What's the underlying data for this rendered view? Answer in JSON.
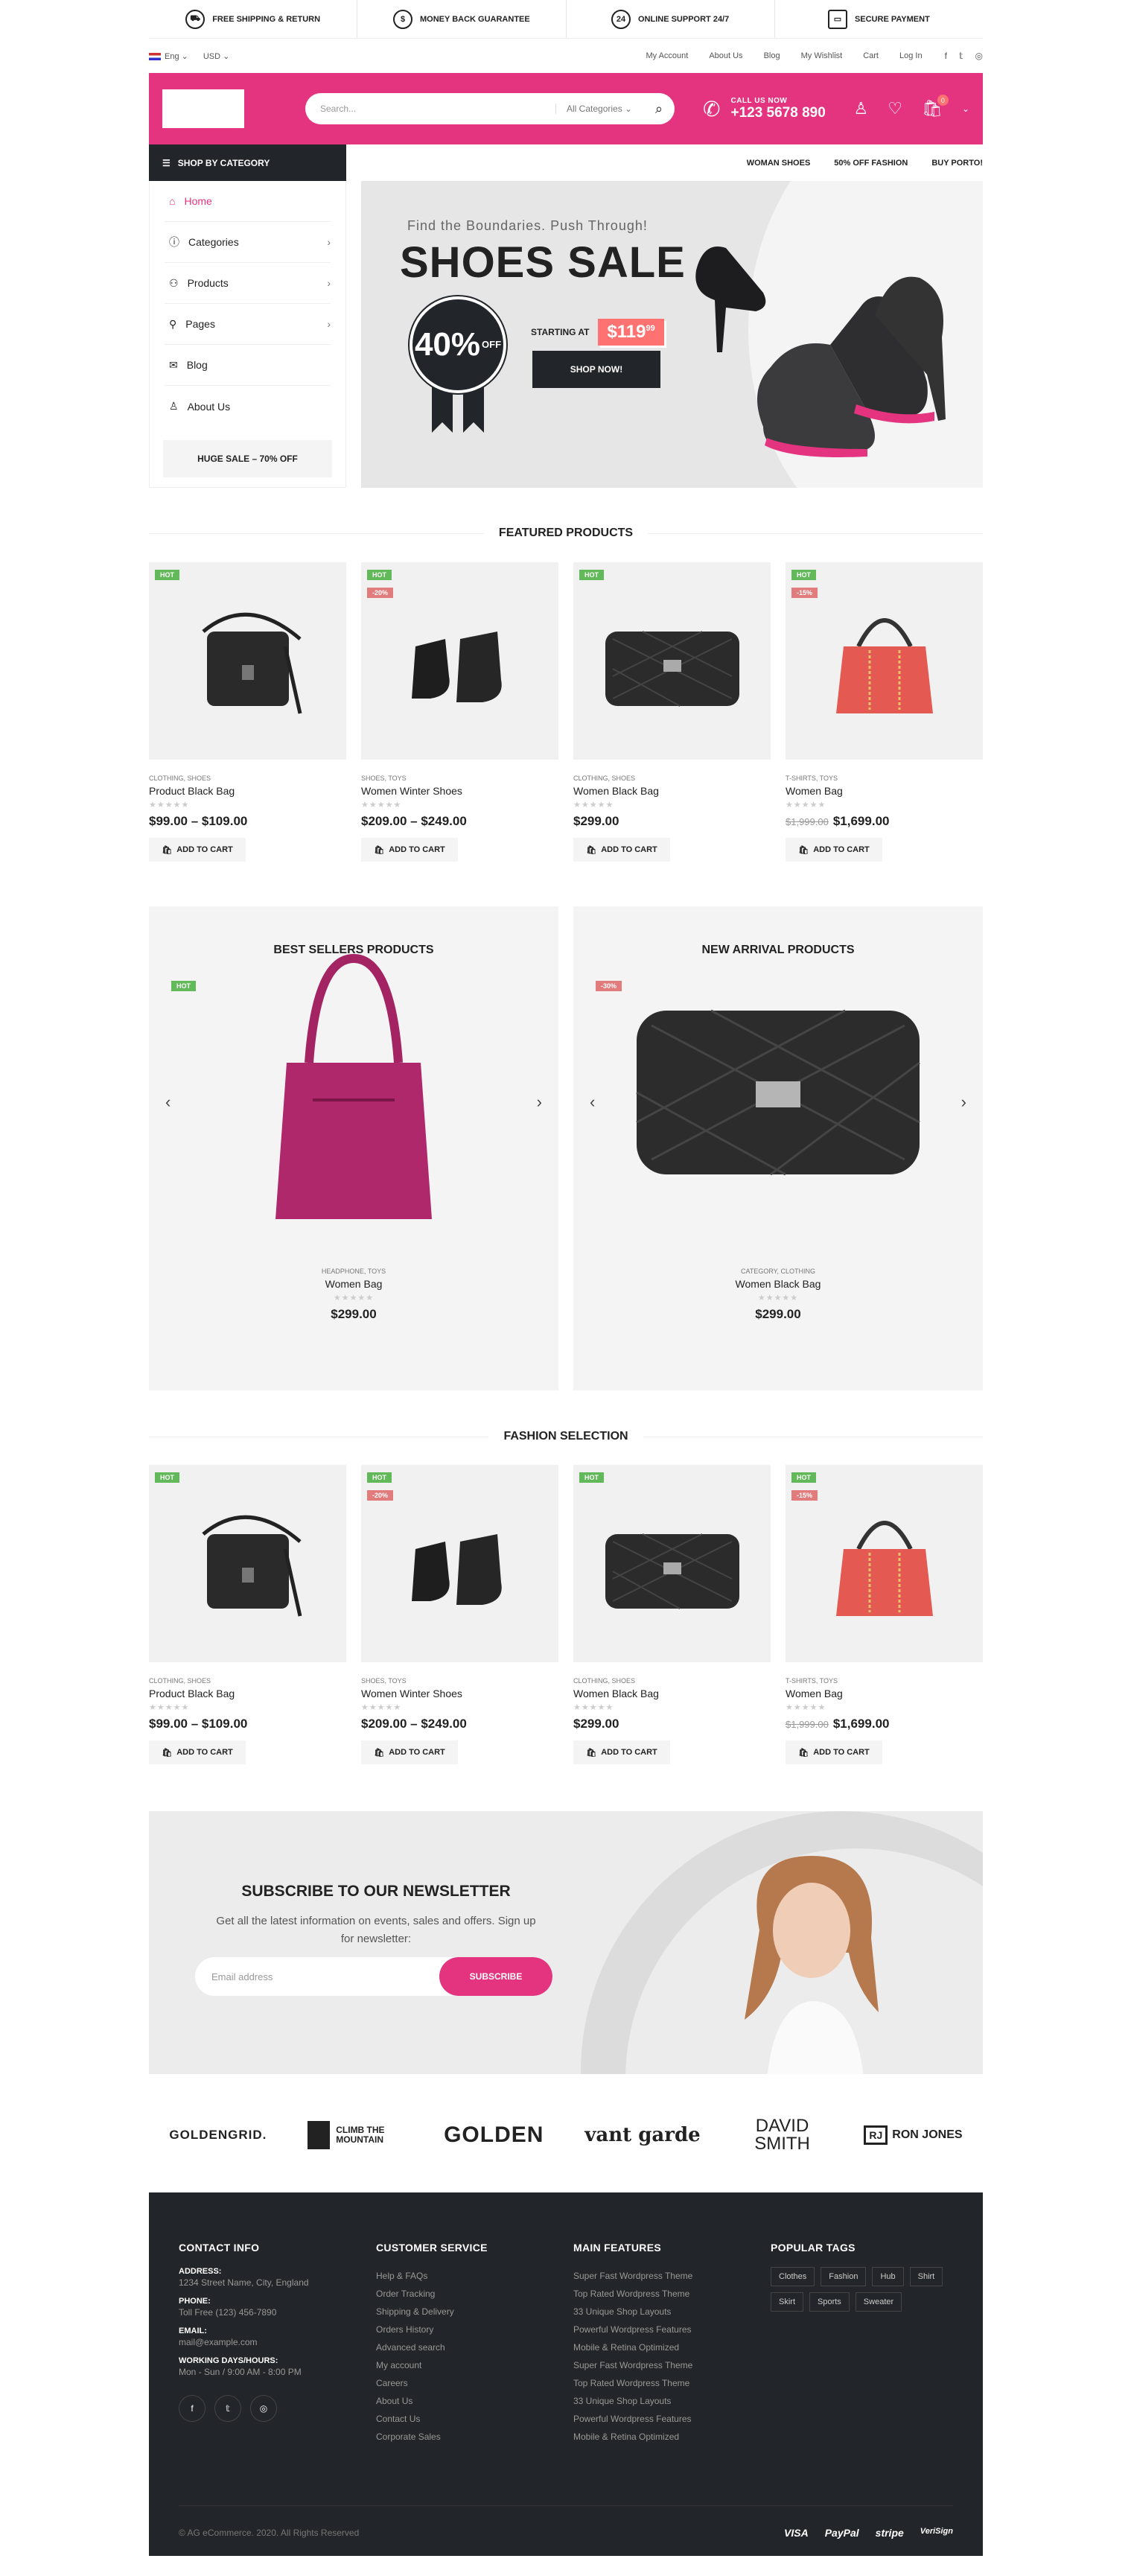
{
  "features": [
    {
      "label": "FREE SHIPPING & RETURN",
      "icon": "truck-icon"
    },
    {
      "label": "MONEY BACK GUARANTEE",
      "icon": "dollar-icon"
    },
    {
      "label": "ONLINE SUPPORT 24/7",
      "icon": "support-icon"
    },
    {
      "label": "SECURE PAYMENT",
      "icon": "card-icon"
    }
  ],
  "topbar": {
    "lang": "Eng",
    "currency": "USD",
    "links": [
      "My Account",
      "About Us",
      "Blog",
      "My Wishlist",
      "Cart",
      "Log In"
    ]
  },
  "header": {
    "search_placeholder": "Search...",
    "category_select": "All Categories",
    "call_label": "CALL US NOW",
    "phone": "+123 5678 890",
    "cart_count": "0",
    "accent": "#e4347f"
  },
  "catbar_label": "SHOP BY CATEGORY",
  "topnav": [
    "WOMAN SHOES",
    "50% OFF FASHION",
    "BUY PORTO!"
  ],
  "sidebar": {
    "items": [
      "Home",
      "Categories",
      "Products",
      "Pages",
      "Blog",
      "About Us"
    ],
    "sale": "HUGE SALE – 70% OFF"
  },
  "banner": {
    "tagline": "Find the Boundaries. Push Through!",
    "title": "SHOES SALE",
    "discount": "40%",
    "off": "OFF",
    "starting": "STARTING AT",
    "price": "$119",
    "price_cents": "99",
    "cta": "SHOP NOW!"
  },
  "featured_title": "FEATURED PRODUCTS",
  "products": [
    {
      "cat": "CLOTHING, SHOES",
      "name": "Product Black Bag",
      "price": "$99.00 – $109.00",
      "old": "",
      "hot": "HOT",
      "sale": ""
    },
    {
      "cat": "SHOES, TOYS",
      "name": "Women Winter Shoes",
      "price": "$209.00 – $249.00",
      "old": "",
      "hot": "HOT",
      "sale": "-20%"
    },
    {
      "cat": "CLOTHING, SHOES",
      "name": "Women Black Bag",
      "price": "$299.00",
      "old": "",
      "hot": "HOT",
      "sale": ""
    },
    {
      "cat": "T-SHIRTS, TOYS",
      "name": "Women Bag",
      "price": "$1,699.00",
      "old": "$1,999.00",
      "hot": "HOT",
      "sale": "-15%"
    }
  ],
  "add_to_cart": "ADD TO CART",
  "bestsellers": {
    "title": "BEST SELLERS PRODUCTS",
    "label": "HOT",
    "cat": "HEADPHONE, TOYS",
    "name": "Women Bag",
    "price": "$299.00"
  },
  "newarrival": {
    "title": "NEW ARRIVAL PRODUCTS",
    "label": "-30%",
    "cat": "CATEGORY, CLOTHING",
    "name": "Women Black Bag",
    "price": "$299.00"
  },
  "fashion_title": "FASHION SELECTION",
  "newsletter": {
    "title": "SUBSCRIBE TO OUR NEWSLETTER",
    "text": "Get all the latest information on events, sales and offers. Sign up for newsletter:",
    "placeholder": "Email address",
    "button": "SUBSCRIBE"
  },
  "brands": [
    "GOLDENGRID.",
    "CLIMB THE MOUNTAIN",
    "GOLDEN",
    "vant garde",
    "DAVID SMITH",
    "RON JONES"
  ],
  "footer": {
    "contact_title": "CONTACT INFO",
    "address_label": "ADDRESS:",
    "address": "1234 Street Name, City, England",
    "phone_label": "PHONE:",
    "phone": "Toll Free (123) 456-7890",
    "email_label": "EMAIL:",
    "email": "mail@example.com",
    "hours_label": "WORKING DAYS/HOURS:",
    "hours": "Mon - Sun / 9:00 AM - 8:00 PM",
    "service_title": "CUSTOMER SERVICE",
    "service": [
      "Help & FAQs",
      "Order Tracking",
      "Shipping & Delivery",
      "Orders History",
      "Advanced search",
      "My account",
      "Careers",
      "About Us",
      "Contact Us",
      "Corporate Sales"
    ],
    "features_title": "MAIN FEATURES",
    "features": [
      "Super Fast Wordpress Theme",
      "Top Rated Wordpress Theme",
      "33 Unique Shop Layouts",
      "Powerful Wordpress Features",
      "Mobile & Retina Optimized",
      "Super Fast Wordpress Theme",
      "Top Rated Wordpress Theme",
      "33 Unique Shop Layouts",
      "Powerful Wordpress Features",
      "Mobile & Retina Optimized"
    ],
    "tags_title": "POPULAR TAGS",
    "tags": [
      "Clothes",
      "Fashion",
      "Hub",
      "Shirt",
      "Skirt",
      "Sports",
      "Sweater"
    ],
    "copyright": "© AG eCommerce. 2020. All Rights Reserved",
    "payments": [
      "VISA",
      "PayPal",
      "stripe",
      "VeriSign"
    ]
  }
}
